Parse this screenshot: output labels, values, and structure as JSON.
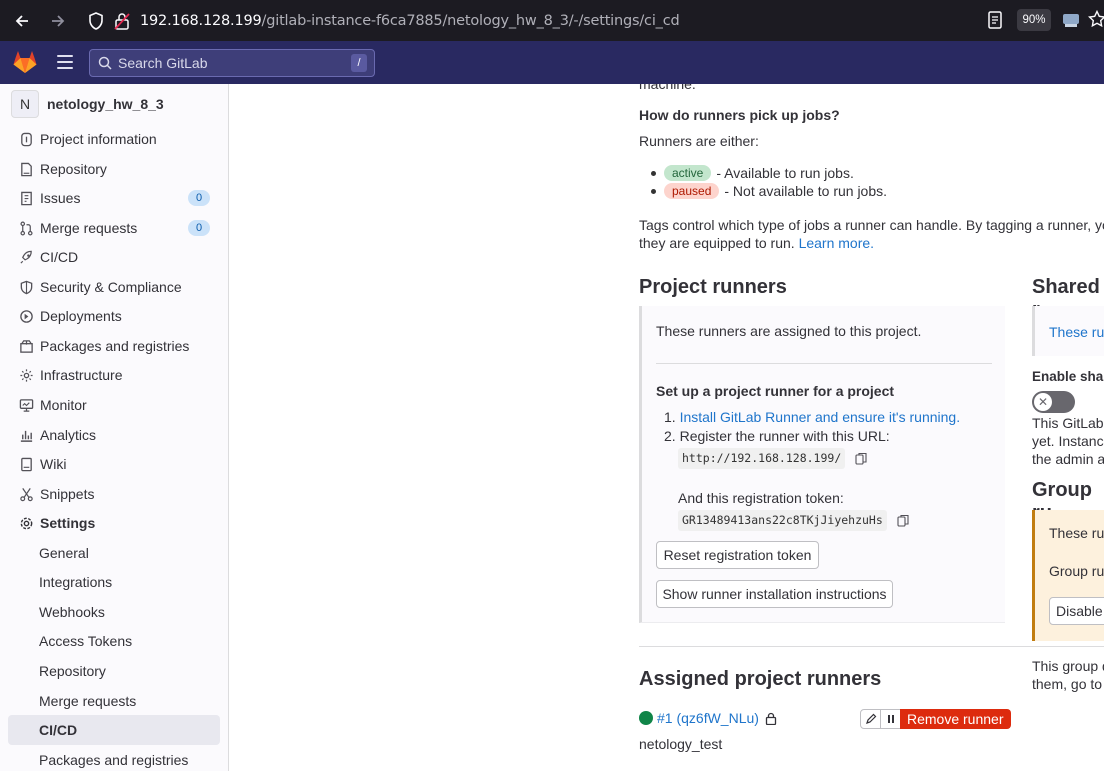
{
  "browser": {
    "url_host": "192.168.128.199",
    "url_path": "/gitlab-instance-f6ca7885/netology_hw_8_3/-/settings/ci_cd",
    "zoom": "90%"
  },
  "header": {
    "search_placeholder": "Search GitLab",
    "search_shortcut": "/"
  },
  "sidebar": {
    "project_initial": "N",
    "project_name": "netology_hw_8_3",
    "items": [
      {
        "label": "Project information",
        "icon": "info-icon"
      },
      {
        "label": "Repository",
        "icon": "doc-icon"
      },
      {
        "label": "Issues",
        "icon": "issues-icon",
        "count": "0"
      },
      {
        "label": "Merge requests",
        "icon": "merge-icon",
        "count": "0"
      },
      {
        "label": "CI/CD",
        "icon": "rocket-icon"
      },
      {
        "label": "Security & Compliance",
        "icon": "shield-icon"
      },
      {
        "label": "Deployments",
        "icon": "deploy-icon"
      },
      {
        "label": "Packages and registries",
        "icon": "package-icon"
      },
      {
        "label": "Infrastructure",
        "icon": "cloud-gear-icon"
      },
      {
        "label": "Monitor",
        "icon": "monitor-icon"
      },
      {
        "label": "Analytics",
        "icon": "chart-icon"
      },
      {
        "label": "Wiki",
        "icon": "book-icon"
      },
      {
        "label": "Snippets",
        "icon": "scissors-icon"
      },
      {
        "label": "Settings",
        "icon": "gear-icon"
      }
    ],
    "settings_sub": [
      "General",
      "Integrations",
      "Webhooks",
      "Access Tokens",
      "Repository",
      "Merge requests",
      "CI/CD",
      "Packages and registries"
    ]
  },
  "main": {
    "cut_top_text": "machine.",
    "how_heading": "How do runners pick up jobs?",
    "either_text": "Runners are either:",
    "status_active": "active",
    "status_active_desc": "- Available to run jobs.",
    "status_paused": "paused",
    "status_paused_desc": "- Not available to run jobs.",
    "tags_line1": "Tags control which type of jobs a runner can handle. By tagging a runner, you m",
    "tags_line2": "they are equipped to run.",
    "learn_more": "Learn more.",
    "project_runners_heading": "Project runners",
    "assigned_text": "These runners are assigned to this project.",
    "setup_heading": "Set up a project runner for a project",
    "step1_num": "1.",
    "step1_link": "Install GitLab Runner and ensure it's running.",
    "step2_num": "2.",
    "step2_text": "Register the runner with this URL:",
    "runner_url": "http://192.168.128.199/",
    "token_label": "And this registration token:",
    "token": "GR13489413ans22c8TKjJiyehzuHs",
    "reset_button": "Reset registration token",
    "show_button": "Show runner installation instructions",
    "assigned_heading": "Assigned project runners",
    "runner_id": "#1 (qz6fW_NLu)",
    "runner_name": "netology_test",
    "remove_button": "Remove runner"
  },
  "right": {
    "shared_heading": "Shared r",
    "shared_box_text": "These run",
    "enable_label": "Enable share",
    "para_line1": "This GitLab i",
    "para_line2": "yet. Instance",
    "para_line3": "the admin ar",
    "group_heading": "Group ru",
    "group_t1": "These run",
    "group_t2": "Group run",
    "disable_btn": "Disable",
    "group_para1": "This group d",
    "group_para2": "them, go to"
  },
  "colors": {
    "header_bg": "#292961",
    "link": "#1f75cb",
    "danger": "#dd2b0e",
    "success": "#108548"
  }
}
